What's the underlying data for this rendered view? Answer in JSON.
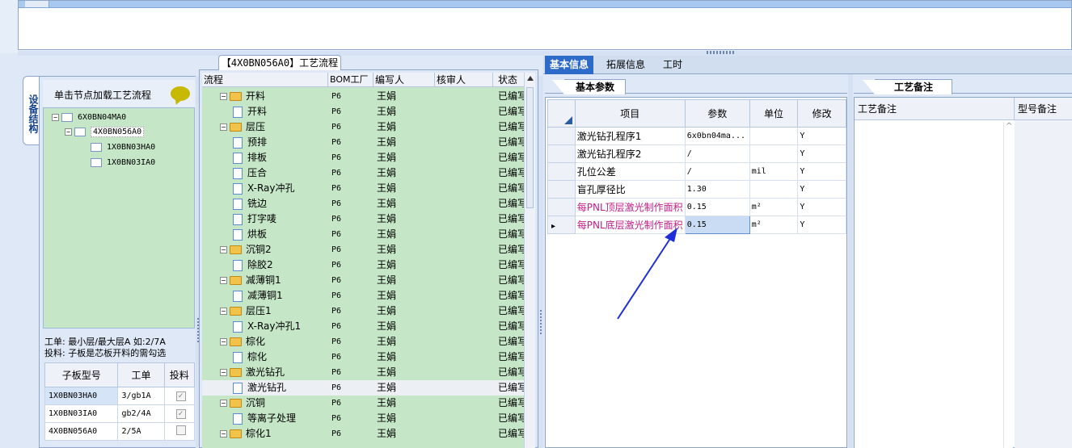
{
  "left_panel": {
    "vertical_tab": "设备结构",
    "load_hint": "单击节点加载工艺流程",
    "tree": [
      {
        "label": "6X0BN04MA0",
        "level": 0,
        "expanded": true
      },
      {
        "label": "4X0BN056A0",
        "level": 1,
        "expanded": true,
        "selected": true
      },
      {
        "label": "1X0BN03HA0",
        "level": 2
      },
      {
        "label": "1X0BN03IA0",
        "level": 2
      }
    ],
    "note_line1": "工单: 最小层/最大层A 如:2/7A",
    "note_line2": "投料: 子板是芯板开料的需勾选",
    "sub_table": {
      "headers": [
        "子板型号",
        "工单",
        "投料"
      ],
      "rows": [
        {
          "model": "1X0BN03HA0",
          "order": "3/gb1A",
          "feed": "✓"
        },
        {
          "model": "1X0BN03IA0",
          "order": "gb2/4A",
          "feed": "✓"
        },
        {
          "model": "4X0BN056A0",
          "order": "2/5A",
          "feed": ""
        }
      ]
    }
  },
  "flow": {
    "title": "【4X0BN056A0】工艺流程",
    "headers": [
      "流程",
      "BOM工厂",
      "编写人",
      "核审人",
      "状态"
    ],
    "rows": [
      {
        "name": "开料",
        "kind": "folder",
        "bom": "P6",
        "writer": "王娟",
        "state": "已编写"
      },
      {
        "name": "开料",
        "kind": "doc",
        "bom": "P6",
        "writer": "王娟",
        "state": "已编写"
      },
      {
        "name": "层压",
        "kind": "folder",
        "bom": "P6",
        "writer": "王娟",
        "state": "已编写"
      },
      {
        "name": "预排",
        "kind": "doc",
        "bom": "P6",
        "writer": "王娟",
        "state": "已编写"
      },
      {
        "name": "排板",
        "kind": "doc",
        "bom": "P6",
        "writer": "王娟",
        "state": "已编写"
      },
      {
        "name": "压合",
        "kind": "doc",
        "bom": "P6",
        "writer": "王娟",
        "state": "已编写"
      },
      {
        "name": "X-Ray冲孔",
        "kind": "doc",
        "bom": "P6",
        "writer": "王娟",
        "state": "已编写"
      },
      {
        "name": "铣边",
        "kind": "doc",
        "bom": "P6",
        "writer": "王娟",
        "state": "已编写"
      },
      {
        "name": "打字唛",
        "kind": "doc",
        "bom": "P6",
        "writer": "王娟",
        "state": "已编写"
      },
      {
        "name": "烘板",
        "kind": "doc",
        "bom": "P6",
        "writer": "王娟",
        "state": "已编写"
      },
      {
        "name": "沉铜2",
        "kind": "folder",
        "bom": "P6",
        "writer": "王娟",
        "state": "已编写"
      },
      {
        "name": "除胶2",
        "kind": "doc",
        "bom": "P6",
        "writer": "王娟",
        "state": "已编写"
      },
      {
        "name": "减薄铜1",
        "kind": "folder",
        "bom": "P6",
        "writer": "王娟",
        "state": "已编写"
      },
      {
        "name": "减薄铜1",
        "kind": "doc",
        "bom": "P6",
        "writer": "王娟",
        "state": "已编写"
      },
      {
        "name": "层压1",
        "kind": "folder",
        "bom": "P6",
        "writer": "王娟",
        "state": "已编写"
      },
      {
        "name": "X-Ray冲孔1",
        "kind": "doc",
        "bom": "P6",
        "writer": "王娟",
        "state": "已编写"
      },
      {
        "name": "棕化",
        "kind": "folder",
        "bom": "P6",
        "writer": "王娟",
        "state": "已编写"
      },
      {
        "name": "棕化",
        "kind": "doc",
        "bom": "P6",
        "writer": "王娟",
        "state": "已编写"
      },
      {
        "name": "激光钻孔",
        "kind": "folder",
        "bom": "P6",
        "writer": "王娟",
        "state": "已编写"
      },
      {
        "name": "激光钻孔",
        "kind": "doc",
        "bom": "P6",
        "writer": "王娟",
        "state": "已编写",
        "selected": true
      },
      {
        "name": "沉铜",
        "kind": "folder",
        "bom": "P6",
        "writer": "王娟",
        "state": "已编写"
      },
      {
        "name": "等离子处理",
        "kind": "doc",
        "bom": "P6",
        "writer": "王娟",
        "state": "已编写"
      },
      {
        "name": "棕化1",
        "kind": "folder",
        "bom": "P6",
        "writer": "王娟",
        "state": "已编写"
      }
    ]
  },
  "right": {
    "tabs": [
      "基本信息",
      "拓展信息",
      "工时"
    ],
    "active_tab": "基本信息",
    "sub_tab": "基本参数",
    "param_headers": [
      "项目",
      "参数",
      "单位",
      "修改"
    ],
    "params": [
      {
        "name": "激光钻孔程序1",
        "value": "6x0bn04ma...",
        "unit": "",
        "mod": "Y",
        "pink": false
      },
      {
        "name": "激光钻孔程序2",
        "value": "/",
        "unit": "",
        "mod": "Y",
        "pink": false
      },
      {
        "name": "孔位公差",
        "value": "/",
        "unit": "mil",
        "mod": "Y",
        "pink": false
      },
      {
        "name": "盲孔厚径比",
        "value": "1.30",
        "unit": "",
        "mod": "Y",
        "pink": false
      },
      {
        "name": "每PNL顶层激光制作面积",
        "value": "0.15",
        "unit": "m²",
        "mod": "Y",
        "pink": true
      },
      {
        "name": "每PNL底层激光制作面积",
        "value": "0.15",
        "unit": "m²",
        "mod": "Y",
        "pink": true,
        "current": true
      }
    ],
    "notes_tab": "工艺备注",
    "notes_headers": [
      "工艺备注",
      "型号备注"
    ]
  },
  "colors": {
    "tree_bg": "#c6e6c8",
    "active_tab": "#2e6bc9",
    "pink_text": "#c0208a",
    "annotation_arrow": "#1f2fd8"
  }
}
